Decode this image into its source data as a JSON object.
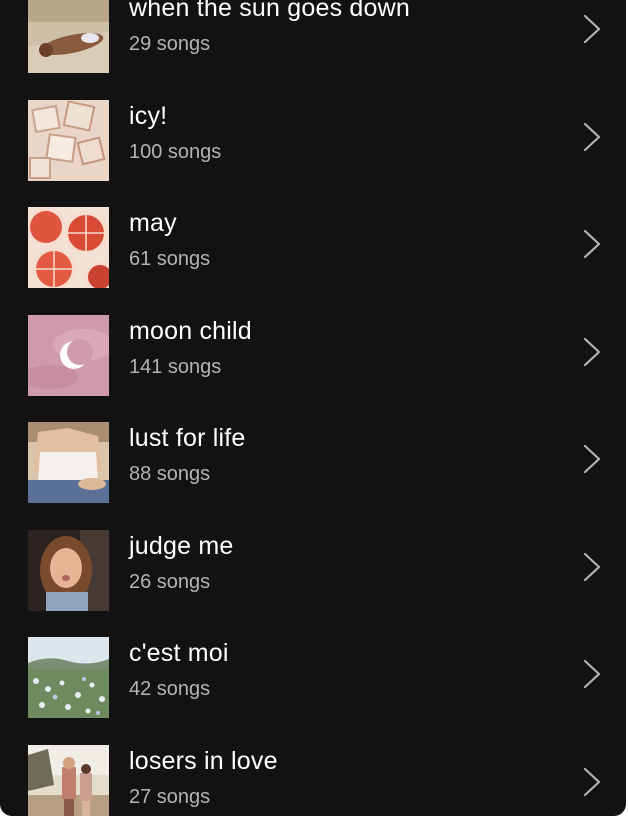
{
  "playlists": [
    {
      "title": "when the sun goes down",
      "count": "29 songs",
      "cover": "sunbathing-photo-icon"
    },
    {
      "title": "icy!",
      "count": "100 songs",
      "cover": "ice-cubes-icon"
    },
    {
      "title": "may",
      "count": "61 songs",
      "cover": "grapefruit-slices-icon"
    },
    {
      "title": "moon child",
      "count": "141 songs",
      "cover": "crescent-moon-icon"
    },
    {
      "title": "lust for life",
      "count": "88 songs",
      "cover": "girl-in-lace-top-icon"
    },
    {
      "title": "judge me",
      "count": "26 songs",
      "cover": "woman-portrait-icon"
    },
    {
      "title": "c'est moi",
      "count": "42 songs",
      "cover": "flower-field-icon"
    },
    {
      "title": "losers in love",
      "count": "27 songs",
      "cover": "couple-walking-icon"
    }
  ],
  "colors": {
    "background": "#121212",
    "title_text": "#ffffff",
    "subtitle_text": "#b3b3b3",
    "chevron": "#b3b3b3"
  }
}
